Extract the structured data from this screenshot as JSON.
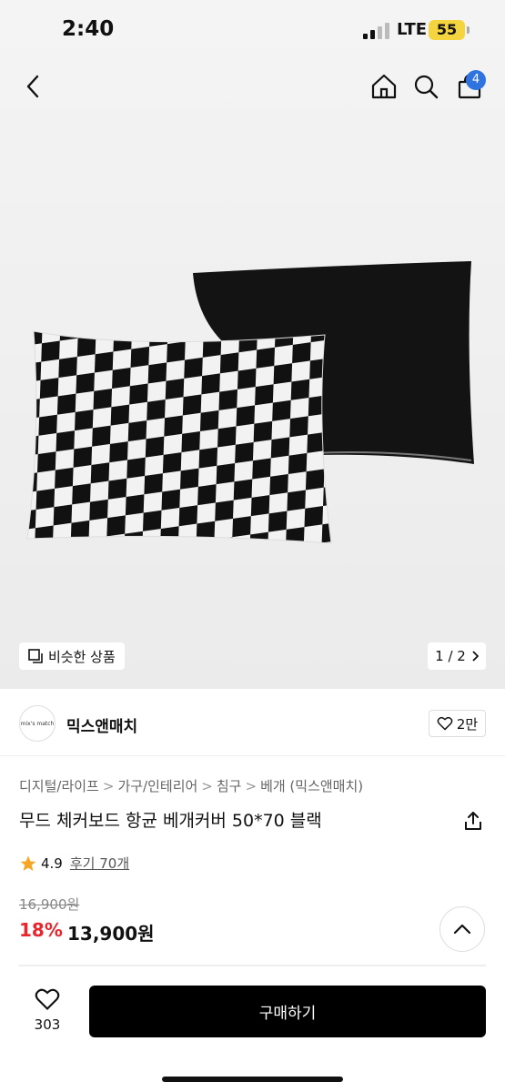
{
  "status_bar": {
    "time": "2:40",
    "network": "LTE",
    "battery": "55"
  },
  "nav": {
    "cart_count": "4"
  },
  "gallery": {
    "similar_label": "비슷한 상품",
    "page": "1 / 2"
  },
  "seller": {
    "logo_text": "mix's match",
    "name": "믹스앤매치",
    "likes": "2만"
  },
  "breadcrumb": [
    "디지털/라이프",
    "가구/인테리어",
    "침구",
    "베개 (믹스앤매치)"
  ],
  "product": {
    "title": "무드 체커보드 항균 베개커버 50*70 블랙",
    "rating": "4.9",
    "review_label": "후기 70개",
    "original_price": "16,900원",
    "discount": "18%",
    "price": "13,900원"
  },
  "bottom": {
    "wish_count": "303",
    "buy_label": "구매하기"
  },
  "colors": {
    "accent_red": "#e8262e",
    "badge_blue": "#2f73e0",
    "star": "#f5a623",
    "battery": "#f5d53f"
  }
}
